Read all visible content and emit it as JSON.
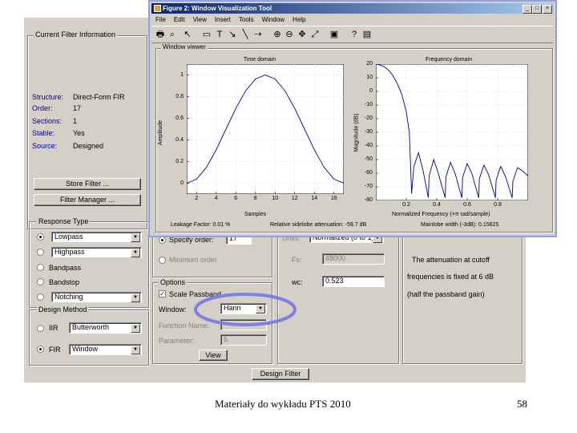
{
  "figure": {
    "title": "Figure 2: Window Visualization Tool",
    "menu": [
      "File",
      "Edit",
      "View",
      "Insert",
      "Tools",
      "Window",
      "Help"
    ],
    "caption_buttons": [
      "_",
      "□",
      "×"
    ],
    "toolbar_icons": [
      "print-icon",
      "zoom-page-icon",
      "edit-pointer-icon",
      "rectangle-icon",
      "text-icon",
      "arrow-icon",
      "line-icon",
      "move-icon",
      "zoom-in-icon",
      "zoom-out-icon",
      "pan-icon",
      "full-view-icon",
      "export-icon",
      "help-icon",
      "legend-icon"
    ],
    "viewer_title": "Window viewer",
    "time": {
      "title": "Time domain",
      "xlabel": "Samples",
      "ylabel": "Amplitude",
      "xticks": [
        "2",
        "4",
        "6",
        "8",
        "10",
        "12",
        "14",
        "16"
      ],
      "yticks": [
        "1",
        "0.8",
        "0.6",
        "0.4",
        "0.2",
        "0"
      ]
    },
    "freq": {
      "title": "Frequency domain",
      "xlabel": "Normalized Frequency (×π rad/sample)",
      "ylabel": "Magnitude (dB)",
      "xticks": [
        "0.2",
        "0.4",
        "0.6",
        "0.8"
      ],
      "yticks": [
        "20",
        "10",
        "0",
        "-10",
        "-20",
        "-30",
        "-40",
        "-50",
        "-60",
        "-70",
        "-80"
      ]
    },
    "leakage": "Leakage Factor: 0.01 %",
    "sidelobe": "Relative sidelobe attenuation: -59.7 dB",
    "mainlobe": "Mainlobe width (-3dB): 0.15625"
  },
  "chart_data": [
    {
      "type": "line",
      "title": "Time domain",
      "xlabel": "Samples",
      "ylabel": "Amplitude",
      "xlim": [
        1,
        17
      ],
      "ylim": [
        -0.1,
        1.1
      ],
      "series": [
        {
          "x": [
            1,
            2,
            3,
            4,
            5,
            6,
            7,
            8,
            9,
            10,
            11,
            12,
            13,
            14,
            15,
            16,
            17
          ],
          "values": [
            0.0,
            0.038,
            0.146,
            0.309,
            0.5,
            0.691,
            0.854,
            0.962,
            1.0,
            0.962,
            0.854,
            0.691,
            0.5,
            0.309,
            0.146,
            0.038,
            0.0
          ]
        }
      ]
    },
    {
      "type": "line",
      "title": "Frequency domain",
      "xlabel": "Normalized Frequency (×π rad/sample)",
      "ylabel": "Magnitude (dB)",
      "xlim": [
        0,
        1
      ],
      "ylim": [
        -80,
        20
      ],
      "series": [
        {
          "x": [
            0,
            0.02,
            0.05,
            0.08,
            0.11,
            0.14,
            0.17,
            0.2,
            0.22,
            0.235,
            0.25,
            0.28,
            0.31,
            0.345,
            0.35,
            0.38,
            0.41,
            0.455,
            0.46,
            0.49,
            0.52,
            0.565,
            0.57,
            0.6,
            0.63,
            0.675,
            0.68,
            0.71,
            0.74,
            0.785,
            0.79,
            0.82,
            0.85,
            0.895,
            0.9,
            0.93,
            0.96,
            1.0
          ],
          "values": [
            20,
            19.6,
            18.5,
            16,
            12,
            6,
            -2,
            -15,
            -30,
            -75,
            -55,
            -45,
            -58,
            -78,
            -62,
            -50,
            -60,
            -78,
            -63,
            -52,
            -60,
            -78,
            -63,
            -53,
            -60,
            -78,
            -64,
            -54,
            -61,
            -78,
            -65,
            -55,
            -62,
            -78,
            -66,
            -56,
            -58,
            -62
          ]
        }
      ]
    }
  ],
  "left": {
    "current_filter_title": "Current Filter Information",
    "info_labels": [
      "Structure:",
      "Order:",
      "Sections:",
      "Stable:",
      "Source:"
    ],
    "info_values": [
      "Direct-Form FIR",
      "17",
      "1",
      "Yes",
      "Designed"
    ],
    "store_filter": "Store Filter ...",
    "filter_manager": "Filter Manager ...",
    "response_type_title": "Response Type",
    "response": [
      {
        "label": "Lowpass",
        "kind": "combo"
      },
      {
        "label": "Highpass",
        "kind": "combo"
      },
      {
        "label": "Bandpass",
        "kind": "text"
      },
      {
        "label": "Bandstop",
        "kind": "text"
      },
      {
        "label": "Notching",
        "kind": "combo"
      }
    ],
    "design_method_title": "Design Method",
    "iir_label": "IIR",
    "iir_value": "Butterworth",
    "fir_label": "FIR",
    "fir_value": "Window"
  },
  "middle": {
    "specify_order": "Specify order:",
    "order_value": "17",
    "minimum_order": "Minimum order",
    "options_title": "Options",
    "scale_passband": "Scale Passband",
    "window_label": "Window:",
    "window_value": "Hann",
    "function_name_label": "Function Name:",
    "parameter_label": "Parameter:",
    "parameter_value": "6",
    "view_button": "View"
  },
  "right": {
    "units_label": "Units:",
    "units_value": "Normalized (0 to 1)",
    "fs_label": "Fs:",
    "fs_value": "48000",
    "wc_label": "wc:",
    "wc_value": "0.523",
    "notes": [
      "The attenuation at cutoff",
      "frequencies is fixed at 6 dB",
      "(half the passband gain)"
    ]
  },
  "design_filter": "Design Filter",
  "footer": {
    "caption": "Materiały do wykładu PTS 2010",
    "page": "58"
  },
  "colors": {
    "window_bg": "#d4d0c8",
    "title_gradient_start": "#0a246a",
    "title_gradient_end": "#a6caf0",
    "plot_line": "#00008b",
    "label_blue": "#0000a0",
    "highlight_ellipse": "#8080e0"
  }
}
